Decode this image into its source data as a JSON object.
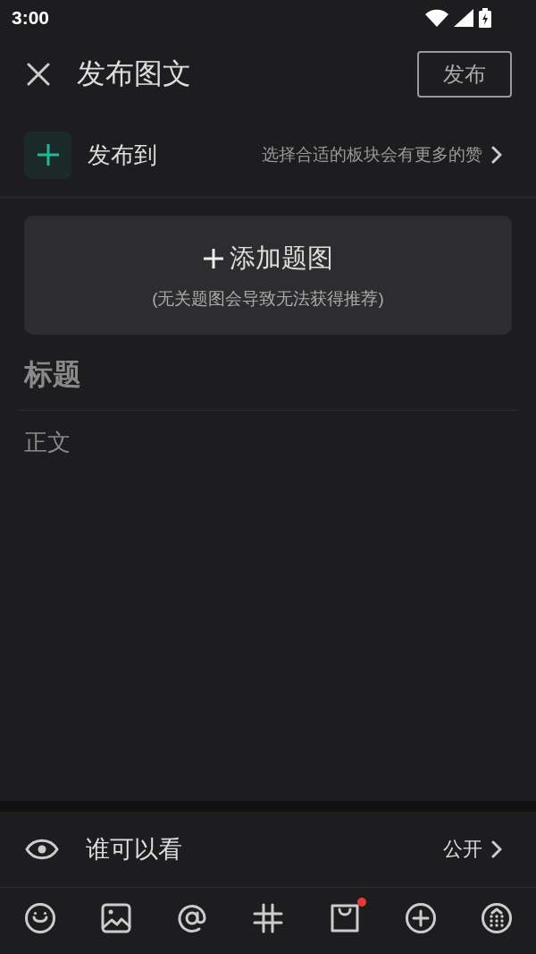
{
  "status_bar": {
    "time": "3:00"
  },
  "header": {
    "title": "发布图文",
    "publish_button": "发布"
  },
  "publish_to": {
    "label": "发布到",
    "hint": "选择合适的板块会有更多的赞"
  },
  "cover": {
    "label": "添加题图",
    "note": "(无关题图会导致无法获得推荐)"
  },
  "editor": {
    "title_placeholder": "标题",
    "body_placeholder": "正文"
  },
  "visibility": {
    "label": "谁可以看",
    "value": "公开"
  },
  "toolbar": [
    {
      "kind": "emoji",
      "badge": false
    },
    {
      "kind": "image",
      "badge": false
    },
    {
      "kind": "mention",
      "badge": false
    },
    {
      "kind": "topic",
      "badge": false
    },
    {
      "kind": "shop",
      "badge": true
    },
    {
      "kind": "add",
      "badge": false
    },
    {
      "kind": "more",
      "badge": false
    }
  ]
}
